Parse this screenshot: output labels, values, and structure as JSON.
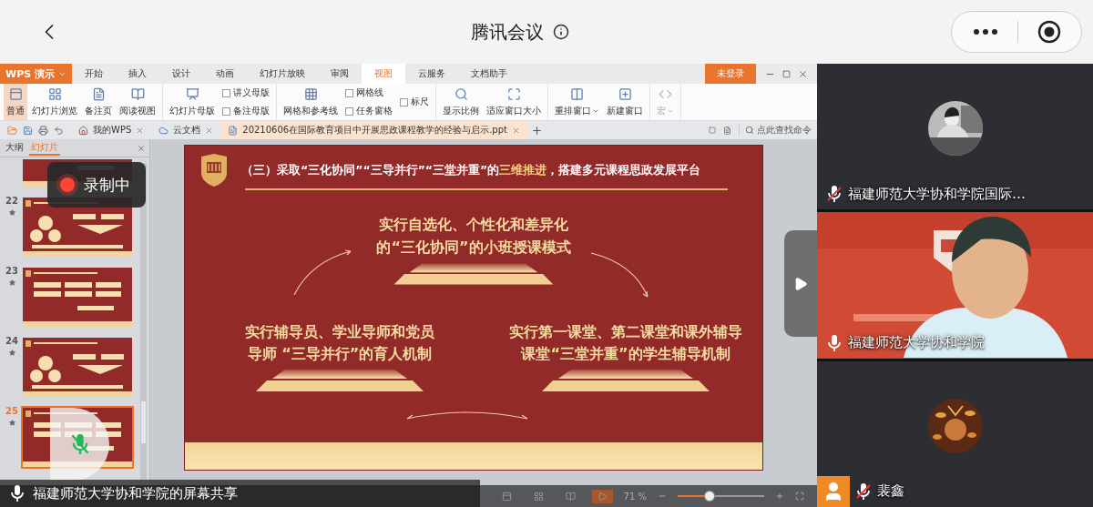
{
  "meeting": {
    "title": "腾讯会议"
  },
  "wps": {
    "app_button": "WPS 演示",
    "menu_tabs": [
      {
        "label": "开始",
        "selected": false
      },
      {
        "label": "插入",
        "selected": false
      },
      {
        "label": "设计",
        "selected": false
      },
      {
        "label": "动画",
        "selected": false
      },
      {
        "label": "幻灯片放映",
        "selected": false
      },
      {
        "label": "审阅",
        "selected": false
      },
      {
        "label": "视图",
        "selected": true
      },
      {
        "label": "云服务",
        "selected": false
      },
      {
        "label": "文档助手",
        "selected": false
      }
    ],
    "login": "未登录",
    "ribbon_groups": [
      {
        "items": [
          {
            "kind": "big",
            "label": "普通",
            "selected": true,
            "disabled": false,
            "dropdown": false
          },
          {
            "kind": "big",
            "label": "幻灯片浏览",
            "selected": false,
            "disabled": false,
            "dropdown": false
          },
          {
            "kind": "big",
            "label": "备注页",
            "selected": false,
            "disabled": false,
            "dropdown": false
          },
          {
            "kind": "big",
            "label": "阅读视图",
            "selected": false,
            "disabled": false,
            "dropdown": false
          }
        ]
      },
      {
        "items": [
          {
            "kind": "big",
            "label": "幻灯片母版",
            "selected": false,
            "disabled": false,
            "dropdown": false
          },
          {
            "kind": "checks",
            "options": [
              {
                "label": "讲义母版",
                "checked": false
              },
              {
                "label": "备注母版",
                "checked": false
              }
            ]
          }
        ]
      },
      {
        "items": [
          {
            "kind": "big",
            "label": "网格和参考线",
            "selected": false,
            "disabled": false,
            "dropdown": false
          },
          {
            "kind": "checks",
            "options": [
              {
                "label": "网格线",
                "checked": false
              },
              {
                "label": "任务窗格",
                "checked": false
              }
            ]
          },
          {
            "kind": "checks",
            "options": [
              {
                "label": "标尺",
                "checked": false
              }
            ]
          }
        ]
      },
      {
        "items": [
          {
            "kind": "big",
            "label": "显示比例",
            "selected": false,
            "disabled": false,
            "dropdown": false
          },
          {
            "kind": "big",
            "label": "适应窗口大小",
            "selected": false,
            "disabled": false,
            "dropdown": false
          }
        ]
      },
      {
        "items": [
          {
            "kind": "big",
            "label": "重排窗口",
            "selected": false,
            "disabled": false,
            "dropdown": true
          },
          {
            "kind": "big",
            "label": "新建窗口",
            "selected": false,
            "disabled": false,
            "dropdown": false
          }
        ]
      },
      {
        "items": [
          {
            "kind": "big",
            "label": "宏",
            "selected": false,
            "disabled": true,
            "dropdown": true
          }
        ]
      }
    ],
    "doc_tabs": [
      {
        "kind": "home",
        "label": "我的WPS",
        "selected": false
      },
      {
        "kind": "cloud",
        "label": "云文档",
        "selected": false
      },
      {
        "kind": "ppt",
        "label": "20210606在国际教育项目中开展思政课程教学的经验与启示.ppt",
        "selected": true
      }
    ],
    "command_search": {
      "placeholder": "点此查找命令"
    },
    "panel_tabs": [
      {
        "label": "大纲",
        "selected": false
      },
      {
        "label": "幻灯片",
        "selected": true
      }
    ],
    "slides": [
      {
        "kind": "cut",
        "selected": false
      },
      {
        "kind": "full",
        "number": "22",
        "selected": false
      },
      {
        "kind": "full",
        "number": "23",
        "selected": false
      },
      {
        "kind": "full",
        "number": "24",
        "selected": false
      },
      {
        "kind": "full",
        "number": "25",
        "selected": true
      }
    ],
    "slide": {
      "title": "（三）采取“三化协同”“三导并行”“三堂并重”的**三维推进**，搭建多元课程思政发展平台",
      "blocks": [
        {
          "lines": [
            "实行自选化、个性化和差异化",
            "的“三化协同”的小班授课模式"
          ]
        },
        {
          "lines": [
            "实行辅导员、学业导师和党员",
            "导师 “三导并行”的育人机制"
          ]
        },
        {
          "lines": [
            "实行第一课堂、第二课堂和课外辅导",
            "课堂“三堂并重”的学生辅导机制"
          ]
        }
      ]
    },
    "zoom": {
      "reading": "71 %",
      "level": 0.35
    }
  },
  "recording": {
    "label": "录制中"
  },
  "share_caption": "福建师范大学协和学院的屏幕共享",
  "participants": [
    {
      "kind": "avatar",
      "name": "福建师范大学协和学院国际…",
      "muted": true
    },
    {
      "kind": "video",
      "name": "福建师范大学协和学院",
      "muted": false
    },
    {
      "kind": "avatar",
      "name": "裴鑫",
      "muted": true
    }
  ]
}
